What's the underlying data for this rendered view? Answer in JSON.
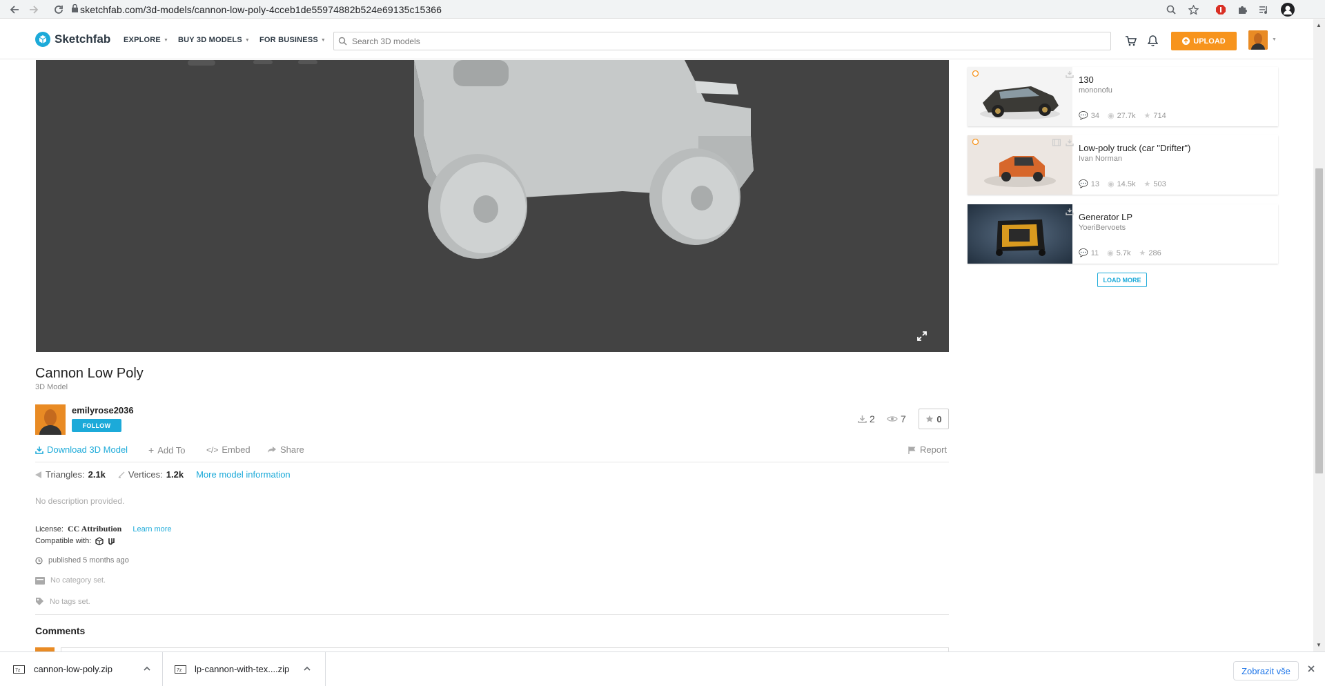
{
  "browser": {
    "url": "sketchfab.com/3d-models/cannon-low-poly-4cceb1de55974882b524e69135c15366"
  },
  "header": {
    "logo_text": "Sketchfab",
    "nav": [
      "EXPLORE",
      "BUY 3D MODELS",
      "FOR BUSINESS"
    ],
    "search_placeholder": "Search 3D models",
    "upload_label": "UPLOAD"
  },
  "model": {
    "title": "Cannon Low Poly",
    "type": "3D Model",
    "author": "emilyrose2036",
    "follow_label": "FOLLOW",
    "downloads": "2",
    "views": "7",
    "likes": "0",
    "actions": {
      "download": "Download 3D Model",
      "add_to": "Add To",
      "embed": "Embed",
      "share": "Share",
      "report": "Report"
    },
    "triangles_label": "Triangles:",
    "triangles": "2.1k",
    "vertices_label": "Vertices:",
    "vertices": "1.2k",
    "more_info": "More model information",
    "description": "No description provided.",
    "license_label": "License:",
    "license": "CC Attribution",
    "learn_more": "Learn more",
    "compatible_label": "Compatible with:",
    "published": "published 5 months ago",
    "category": "No category set.",
    "tags": "No tags set.",
    "comments_title": "Comments"
  },
  "sidebar": {
    "cards": [
      {
        "title": "130",
        "author": "mononofu",
        "comments": "34",
        "views": "27.7k",
        "likes": "714"
      },
      {
        "title": "Low-poly truck (car \"Drifter\")",
        "author": "Ivan Norman",
        "comments": "13",
        "views": "14.5k",
        "likes": "503"
      },
      {
        "title": "Generator LP",
        "author": "YoeriBervoets",
        "comments": "11",
        "views": "5.7k",
        "likes": "286"
      }
    ],
    "load_more": "LOAD MORE"
  },
  "downloads_bar": {
    "items": [
      "cannon-low-poly.zip",
      "lp-cannon-with-tex....zip"
    ],
    "show_all": "Zobrazit vše"
  },
  "colors": {
    "accent": "#1caad9",
    "upload": "#f7941d",
    "viewer_bg": "#434343"
  }
}
